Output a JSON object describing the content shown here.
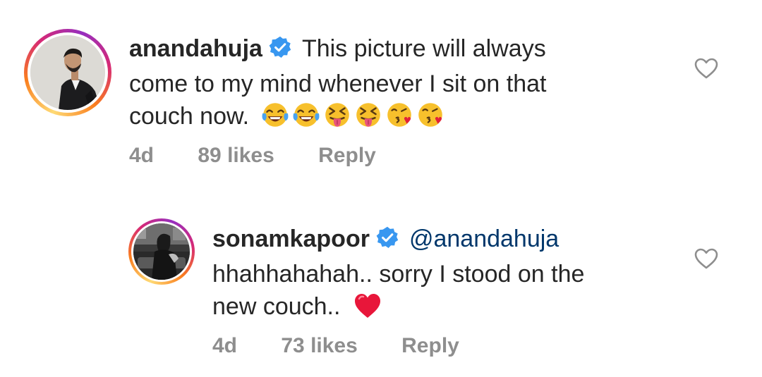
{
  "comments": [
    {
      "username": "anandahuja",
      "verified": true,
      "text_before_emoji": "This picture will always come to my mind whenever I sit on that couch now.",
      "line1": "This picture will always",
      "line2": "come to my mind whenever I sit on that",
      "line3": "couch now.",
      "emojis": [
        "face-with-tears-of-joy",
        "face-with-tears-of-joy",
        "squinting-face-with-tongue",
        "squinting-face-with-tongue",
        "face-blowing-a-kiss",
        "face-blowing-a-kiss"
      ],
      "age": "4d",
      "likes": "89 likes",
      "reply_label": "Reply",
      "like_icon": "heart-outline-icon"
    },
    {
      "username": "sonamkapoor",
      "verified": true,
      "mention": "@anandahuja",
      "line1": "hhahhahahah.. sorry I stood on the",
      "line2": "new couch..",
      "emojis": [
        "red-heart"
      ],
      "age": "4d",
      "likes": "73 likes",
      "reply_label": "Reply",
      "like_icon": "heart-outline-icon"
    }
  ],
  "colors": {
    "text": "#262626",
    "meta": "#8e8e8e",
    "mention": "#00376b",
    "verified": "#3897f0",
    "heart": "#e8163a"
  }
}
